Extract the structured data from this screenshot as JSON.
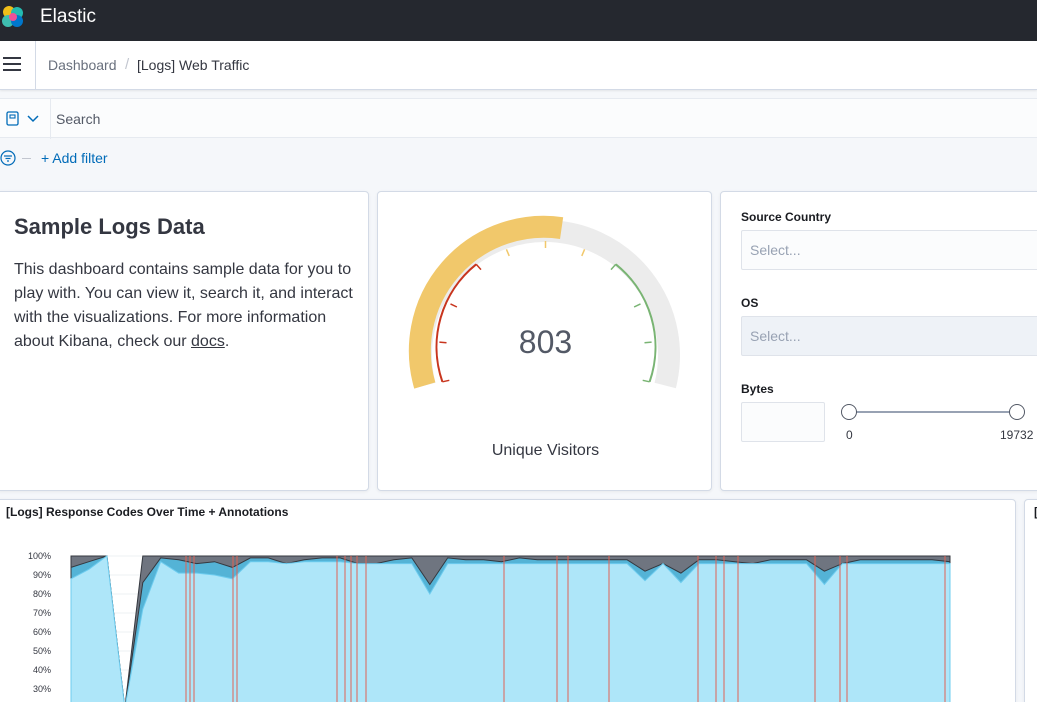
{
  "header": {
    "app_title": "Elastic",
    "logo": "elastic-logo-icon"
  },
  "breadcrumbs": {
    "root": "Dashboard",
    "separator": "/",
    "current": "[Logs] Web Traffic"
  },
  "query_bar": {
    "search_placeholder": "Search",
    "saved_query_icon": "saved-query-icon",
    "dropdown_icon": "chevron-down-icon"
  },
  "filter_bar": {
    "filter_icon": "filter-icon",
    "add_filter_label": "+ Add filter"
  },
  "markdown_panel": {
    "title": "Sample Logs Data",
    "body": "This dashboard contains sample data for you to play with. You can view it, search it, and interact with the visualizations. For more information about Kibana, check our ",
    "link": "docs",
    "trailing": "."
  },
  "gauge_panel": {
    "value": "803",
    "label": "Unique Visitors",
    "colors": {
      "fill": "#f1c86b",
      "track": "#ececec",
      "low": "#c8351e",
      "high": "#79b473"
    }
  },
  "controls_panel": {
    "source_country": {
      "label": "Source Country",
      "placeholder": "Select..."
    },
    "os": {
      "label": "OS",
      "placeholder": "Select..."
    },
    "bytes": {
      "label": "Bytes",
      "min": "0",
      "max": "19732"
    }
  },
  "chart_data": {
    "type": "area",
    "title": "[Logs] Response Codes Over Time + Annotations",
    "y_ticks": [
      "100%",
      "90%",
      "80%",
      "70%",
      "60%",
      "50%",
      "40%",
      "30%"
    ],
    "ylim": [
      30,
      100
    ],
    "series": [
      {
        "color": "#aee6f9",
        "values": [
          88,
          93,
          100,
          20,
          72,
          97,
          91,
          91,
          90,
          88,
          97,
          97,
          96,
          97,
          97,
          97,
          96,
          96,
          96,
          96,
          80,
          96,
          96,
          96,
          96,
          96,
          96,
          96,
          96,
          96,
          96,
          96,
          87,
          96,
          86,
          96,
          96,
          96,
          96,
          96,
          96,
          96,
          85,
          96,
          96,
          96,
          96,
          96,
          96,
          96
        ]
      },
      {
        "color": "#54b3d6",
        "values": [
          94,
          97,
          100,
          20,
          86,
          99,
          98,
          96,
          97,
          94,
          99,
          99,
          96,
          98,
          99,
          99,
          96,
          96,
          98,
          99,
          85,
          99,
          98,
          98,
          97,
          99,
          98,
          98,
          98,
          98,
          98,
          98,
          92,
          96,
          91,
          98,
          98,
          97,
          96,
          98,
          98,
          98,
          92,
          96,
          98,
          98,
          98,
          98,
          98,
          97
        ]
      },
      {
        "color": "#6f7580",
        "values": [
          100,
          100,
          100,
          20,
          100,
          100,
          100,
          100,
          100,
          100,
          100,
          100,
          100,
          100,
          100,
          100,
          100,
          100,
          100,
          100,
          100,
          100,
          100,
          100,
          100,
          100,
          100,
          100,
          100,
          100,
          100,
          100,
          100,
          100,
          100,
          100,
          100,
          100,
          100,
          100,
          100,
          100,
          100,
          100,
          100,
          100,
          100,
          100,
          100,
          100
        ]
      }
    ],
    "annotations_count": 22,
    "annotation_color": "#e06255"
  },
  "edge_panel": {
    "title": "["
  }
}
